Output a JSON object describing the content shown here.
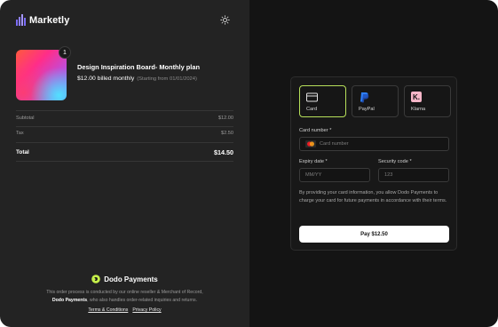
{
  "brand": {
    "name": "Marketly"
  },
  "product": {
    "quantity": "1",
    "name": "Design Inspiration Board- Monthly plan",
    "price": "$12.00 billed monthly",
    "start_note": "(Starting from 01/01/2024)"
  },
  "summary": {
    "subtotal_label": "Subtotal",
    "subtotal_value": "$12.00",
    "tax_label": "Tax",
    "tax_value": "$2.50",
    "total_label": "Total",
    "total_value": "$14.50"
  },
  "footer": {
    "provider_name": "Dodo Payments",
    "legal_line1": "This order process is conducted by our online reseller & Merchant of Record,",
    "legal_bold": "Dodo Payments",
    "legal_line2": ", who also handles order-related inquiries and returns.",
    "terms_link": "Terms & Conditions",
    "privacy_link": "Privacy Policy"
  },
  "payment": {
    "methods": [
      {
        "label": "Card",
        "icon": "card-icon",
        "selected": true
      },
      {
        "label": "PayPal",
        "icon": "paypal-icon",
        "selected": false
      },
      {
        "label": "Klarna",
        "icon": "klarna-icon",
        "selected": false
      }
    ],
    "klarna_glyph": "K.",
    "card_number_label": "Card number *",
    "card_number_placeholder": "Card number",
    "expiry_label": "Expiry date *",
    "expiry_placeholder": "MM/YY",
    "cvc_label": "Security code *",
    "cvc_placeholder": "123",
    "consent": "By providing your card information, you allow Dodo Payments to charge your card for future payments in accordance with their terms.",
    "pay_button": "Pay $12.50"
  },
  "colors": {
    "left_bg": "#232323",
    "right_bg": "#141414",
    "selected_accent": "#b7e05a",
    "dodo_green": "#c6f04a"
  }
}
